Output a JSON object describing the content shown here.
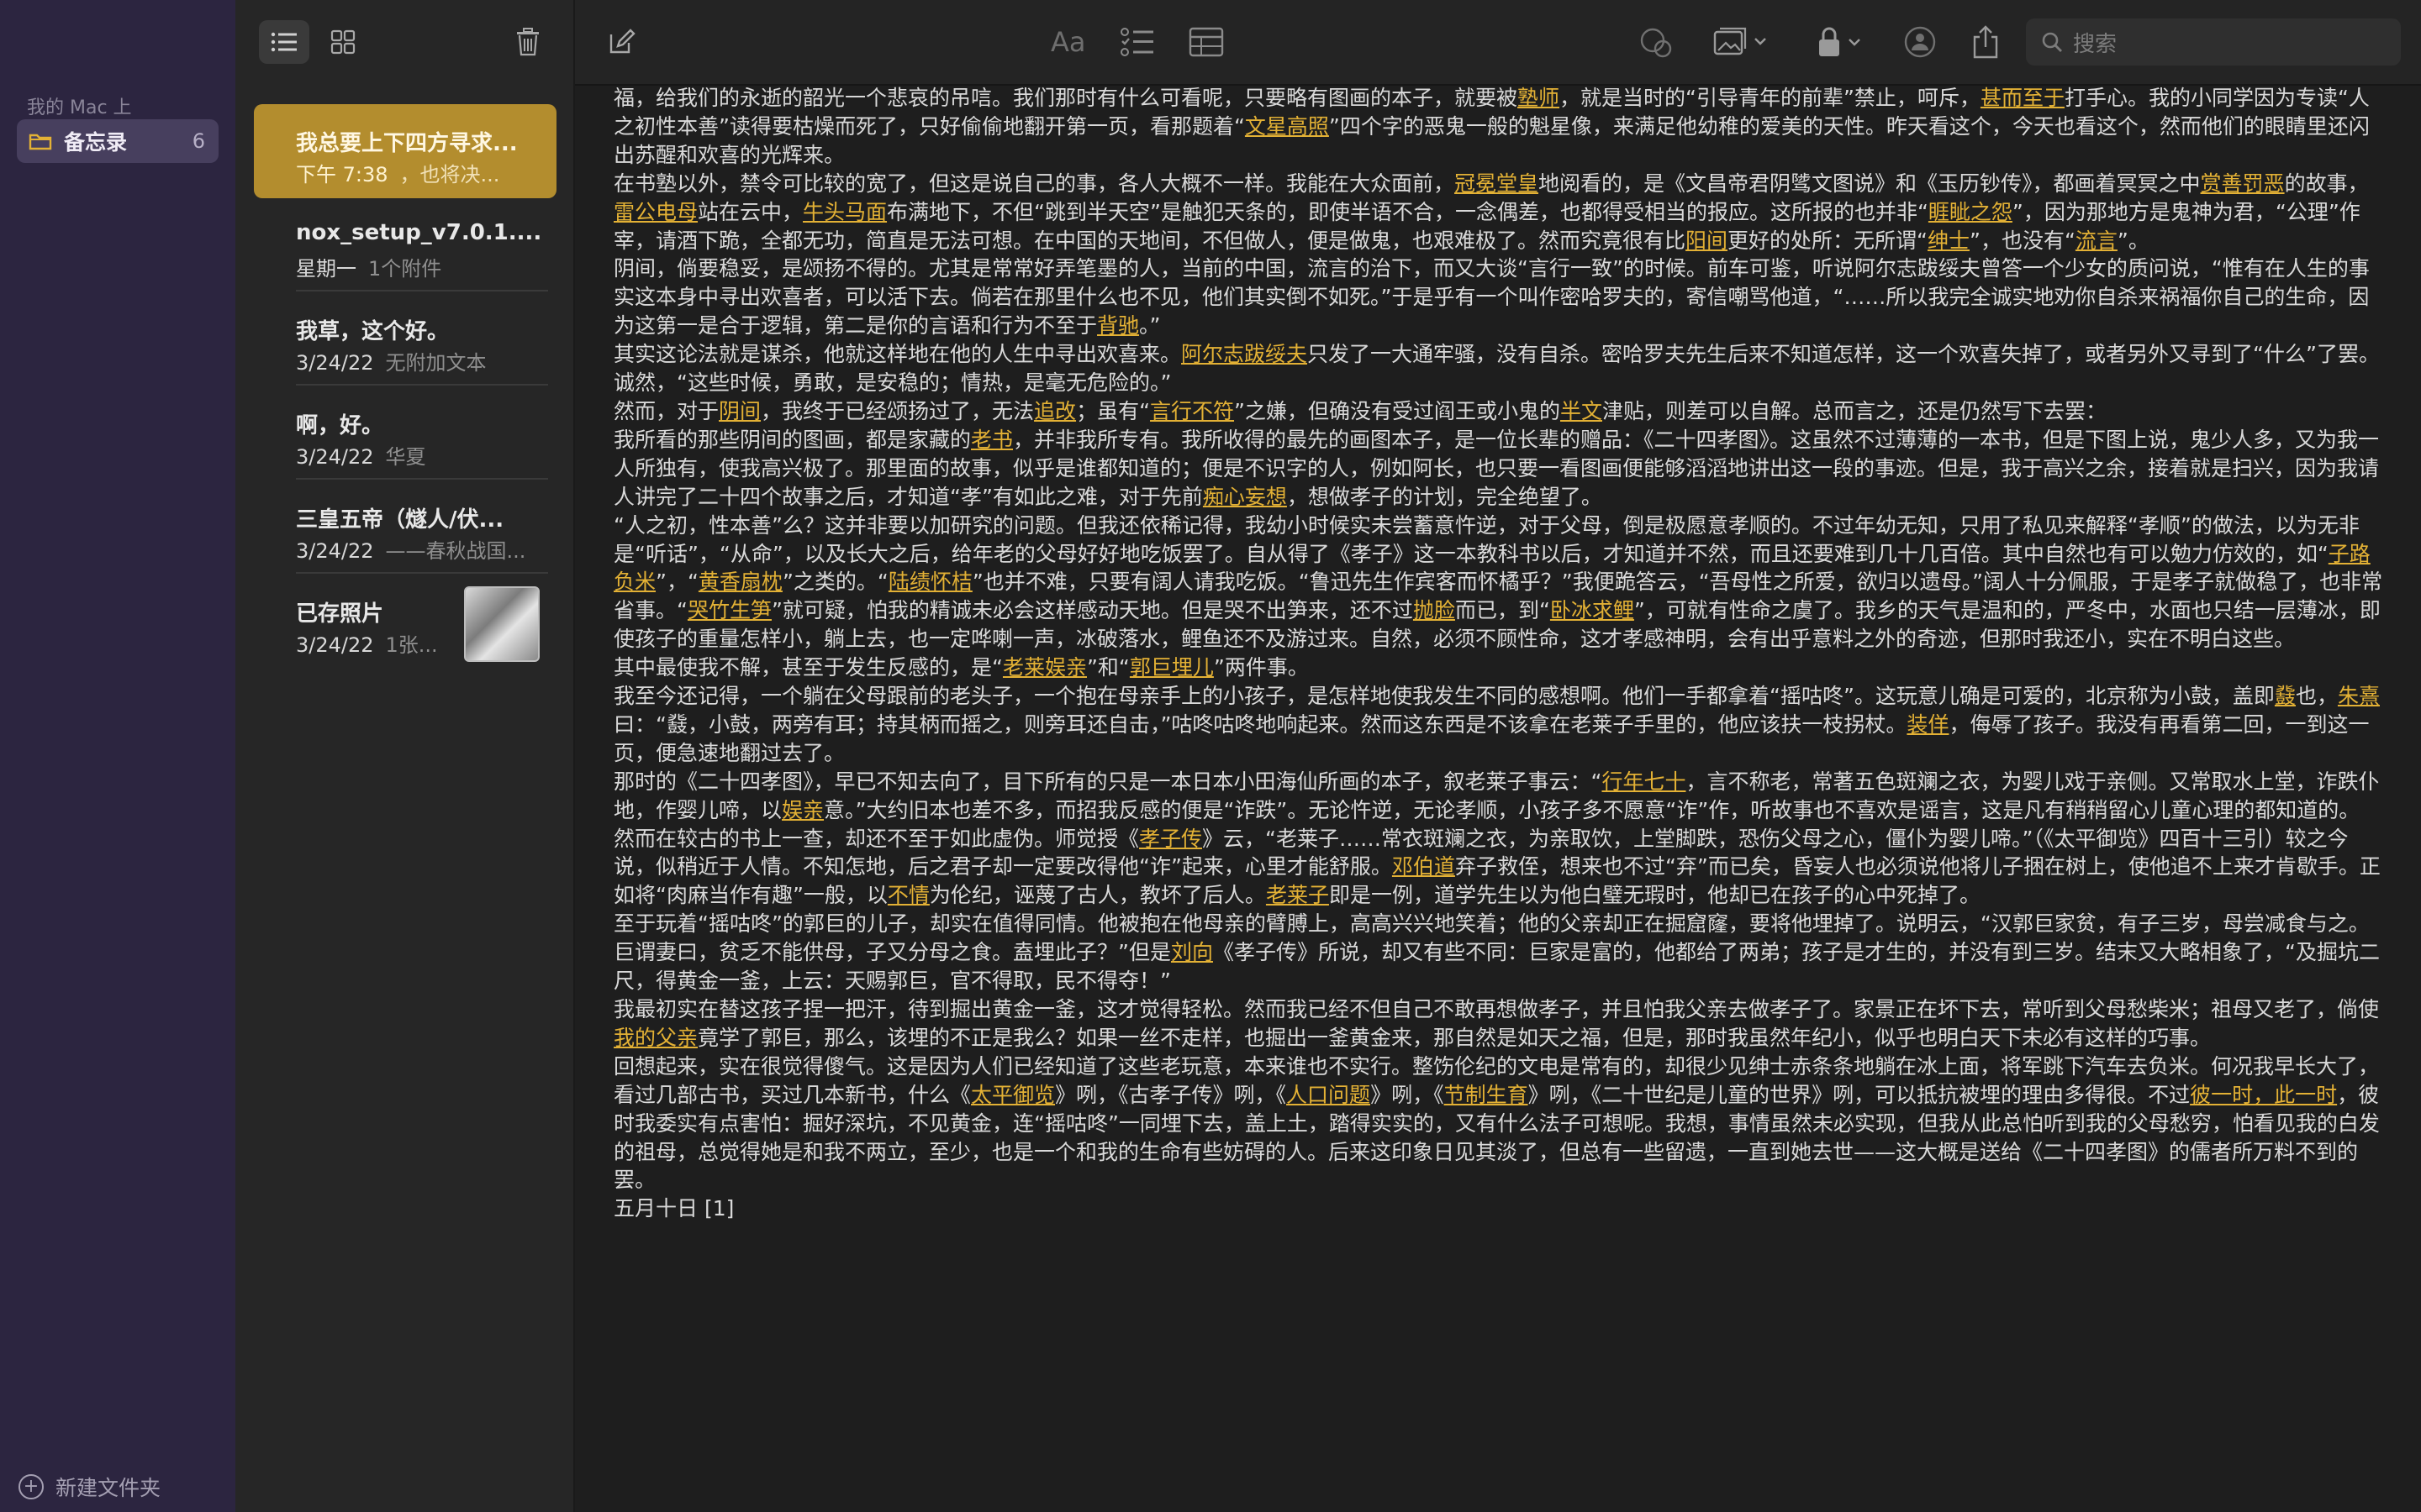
{
  "sidebar": {
    "section_title": "我的 Mac 上",
    "folder": {
      "label": "备忘录",
      "count": "6"
    },
    "new_folder": "新建文件夹"
  },
  "notes": [
    {
      "title": "我总要上下四方寻求...",
      "date": "下午 7:38",
      "preview": "，也将决..."
    },
    {
      "title": "nox_setup_v7.0.1....",
      "date": "星期一",
      "preview": "1个附件"
    },
    {
      "title": "我草，这个好。",
      "date": "3/24/22",
      "preview": "无附加文本"
    },
    {
      "title": "啊，好。",
      "date": "3/24/22",
      "preview": "华夏"
    },
    {
      "title": "三皇五帝（燧人/伏...",
      "date": "3/24/22",
      "preview": "——春秋战国..."
    },
    {
      "title": "已存照片",
      "date": "3/24/22",
      "preview": "1张..."
    }
  ],
  "toolbar": {
    "search_placeholder": "搜索",
    "format_label": "Aa"
  },
  "icons": {
    "list": "list-view-icon",
    "grid": "grid-view-icon",
    "trash": "trash-icon",
    "compose": "compose-icon",
    "checklist": "checklist-icon",
    "table": "table-icon",
    "share": "share-icon",
    "lock": "lock-icon"
  },
  "colors": {
    "accent": "#e3b135",
    "selected_note": "#b38d2e",
    "sidebar_bg": "#2c2540"
  },
  "doc": {
    "segments": [
      {
        "t": "福，给我们的永逝的韶光一个悲哀的吊唁。我们那时有什么可看呢，只要略有图画的本子，就要被"
      },
      {
        "t": "塾师",
        "l": 1
      },
      {
        "t": "，就是当时的“引导青年的前辈”禁止，呵斥，"
      },
      {
        "t": "甚而至于",
        "l": 1
      },
      {
        "t": "打手心。我的小同学因为专读“人之初性本善”读得要枯燥而死了，只好偷偷地翻开第一页，看那题着“"
      },
      {
        "t": "文星高照",
        "l": 1
      },
      {
        "t": "”四个字的恶鬼一般的魁星像，来满足他幼稚的爱美的天性。昨天看这个，今天也看这个，然而他们的眼睛里还闪出苏醒和欢喜的光辉来。\n在书塾以外，禁令可比较的宽了，但这是说自己的事，各人大概不一样。我能在大众面前，"
      },
      {
        "t": "冠冕堂皇",
        "l": 1
      },
      {
        "t": "地阅看的，是《文昌帝君阴骘文图说》和《玉历钞传》，都画着冥冥之中"
      },
      {
        "t": "赏善罚恶",
        "l": 1
      },
      {
        "t": "的故事，"
      },
      {
        "t": "雷公电母",
        "l": 1
      },
      {
        "t": "站在云中，"
      },
      {
        "t": "牛头马面",
        "l": 1
      },
      {
        "t": "布满地下，不但“跳到半天空”是触犯天条的，即使半语不合，一念偶差，也都得受相当的报应。这所报的也并非“"
      },
      {
        "t": "睚眦之怨",
        "l": 1
      },
      {
        "t": "”，因为那地方是鬼神为君，“公理”作宰，请酒下跪，全都无功，简直是无法可想。在中国的天地间，不但做人，便是做鬼，也艰难极了。然而究竟很有比"
      },
      {
        "t": "阳间",
        "l": 1
      },
      {
        "t": "更好的处所：无所谓“"
      },
      {
        "t": "绅士",
        "l": 1
      },
      {
        "t": "”，也没有“"
      },
      {
        "t": "流言",
        "l": 1
      },
      {
        "t": "”。\n阴间，倘要稳妥，是颂扬不得的。尤其是常常好弄笔墨的人，当前的中国，流言的治下，而又大谈“言行一致”的时候。前车可鉴，听说阿尔志跋绥夫曾答一个少女的质问说，“惟有在人生的事实这本身中寻出欢喜者，可以活下去。倘若在那里什么也不见，他们其实倒不如死。”于是乎有一个叫作密哈罗夫的，寄信嘲骂他道，“……所以我完全诚实地劝你自杀来祸福你自己的生命，因为这第一是合于逻辑，第二是你的言语和行为不至于"
      },
      {
        "t": "背驰",
        "l": 1
      },
      {
        "t": "。”\n其实这论法就是谋杀，他就这样地在他的人生中寻出欢喜来。"
      },
      {
        "t": "阿尔志跋绥夫",
        "l": 1
      },
      {
        "t": "只发了一大通牢骚，没有自杀。密哈罗夫先生后来不知道怎样，这一个欢喜失掉了，或者另外又寻到了“什么”了罢。诚然，“这些时候，勇敢，是安稳的；情热，是毫无危险的。”\n然而，对于"
      },
      {
        "t": "阴间",
        "l": 1
      },
      {
        "t": "，我终于已经颂扬过了，无法"
      },
      {
        "t": "追改",
        "l": 1
      },
      {
        "t": "；虽有“"
      },
      {
        "t": "言行不符",
        "l": 1
      },
      {
        "t": "”之嫌，但确没有受过阎王或小鬼的"
      },
      {
        "t": "半文",
        "l": 1
      },
      {
        "t": "津贴，则差可以自解。总而言之，还是仍然写下去罢：\n我所看的那些阴间的图画，都是家藏的"
      },
      {
        "t": "老书",
        "l": 1
      },
      {
        "t": "，并非我所专有。我所收得的最先的画图本子，是一位长辈的赠品：《二十四孝图》。这虽然不过薄薄的一本书，但是下图上说，鬼少人多，又为我一人所独有，使我高兴极了。那里面的故事，似乎是谁都知道的；便是不识字的人，例如阿长，也只要一看图画便能够滔滔地讲出这一段的事迹。但是，我于高兴之余，接着就是扫兴，因为我请人讲完了二十四个故事之后，才知道“孝”有如此之难，对于先前"
      },
      {
        "t": "痴心妄想",
        "l": 1
      },
      {
        "t": "，想做孝子的计划，完全绝望了。\n“人之初，性本善”么？这并非要以加研究的问题。但我还依稀记得，我幼小时候实未尝蓄意忤逆，对于父母，倒是极愿意孝顺的。不过年幼无知，只用了私见来解释“孝顺”的做法，以为无非是“听话”，“从命”，以及长大之后，给年老的父母好好地吃饭罢了。自从得了《孝子》这一本教科书以后，才知道并不然，而且还要难到几十几百倍。其中自然也有可以勉力仿效的，如“"
      },
      {
        "t": "子路负米",
        "l": 1
      },
      {
        "t": "”，“"
      },
      {
        "t": "黄香扇枕",
        "l": 1
      },
      {
        "t": "”之类的。“"
      },
      {
        "t": "陆绩怀桔",
        "l": 1
      },
      {
        "t": "”也并不难，只要有阔人请我吃饭。“鲁迅先生作宾客而怀橘乎？”我便跪答云，“吾母性之所爱，欲归以遗母。”阔人十分佩服，于是孝子就做稳了，也非常省事。“"
      },
      {
        "t": "哭竹生笋",
        "l": 1
      },
      {
        "t": "”就可疑，怕我的精诚未必会这样感动天地。但是哭不出笋来，还不过"
      },
      {
        "t": "抛脸",
        "l": 1
      },
      {
        "t": "而已，到“"
      },
      {
        "t": "卧冰求鲤",
        "l": 1
      },
      {
        "t": "”，可就有性命之虞了。我乡的天气是温和的，严冬中，水面也只结一层薄冰，即使孩子的重量怎样小，躺上去，也一定哗喇一声，冰破落水，鲤鱼还不及游过来。自然，必须不顾性命，这才孝感神明，会有出乎意料之外的奇迹，但那时我还小，实在不明白这些。\n其中最使我不解，甚至于发生反感的，是“"
      },
      {
        "t": "老莱娱亲",
        "l": 1
      },
      {
        "t": "”和“"
      },
      {
        "t": "郭巨埋儿",
        "l": 1
      },
      {
        "t": "”两件事。\n我至今还记得，一个躺在父母跟前的老头子，一个抱在母亲手上的小孩子，是怎样地使我发生不同的感想啊。他们一手都拿着“摇咕咚”。这玩意儿确是可爱的，北京称为小鼓，盖即"
      },
      {
        "t": "鼗",
        "l": 1
      },
      {
        "t": "也，"
      },
      {
        "t": "朱熹",
        "l": 1
      },
      {
        "t": "曰：“鼗，小鼓，两旁有耳；持其柄而摇之，则旁耳还自击，”咕咚咕咚地响起来。然而这东西是不该拿在老莱子手里的，他应该扶一枝拐杖。"
      },
      {
        "t": "装佯",
        "l": 1
      },
      {
        "t": "，侮辱了孩子。我没有再看第二回，一到这一页，便急速地翻过去了。\n那时的《二十四孝图》，早已不知去向了，目下所有的只是一本日本小田海仙所画的本子，叙老莱子事云：“"
      },
      {
        "t": "行年七十",
        "l": 1
      },
      {
        "t": "，言不称老，常著五色斑斓之衣，为婴儿戏于亲侧。又常取水上堂，诈跌仆地，作婴儿啼，以"
      },
      {
        "t": "娱亲",
        "l": 1
      },
      {
        "t": "意。”大约旧本也差不多，而招我反感的便是“诈跌”。无论忤逆，无论孝顺，小孩子多不愿意“诈”作，听故事也不喜欢是谣言，这是凡有稍稍留心儿童心理的都知道的。\n然而在较古的书上一查，却还不至于如此虚伪。师觉授《"
      },
      {
        "t": "孝子传",
        "l": 1
      },
      {
        "t": "》云，“老莱子……常衣斑斓之衣，为亲取饮，上堂脚跌，恐伤父母之心，僵仆为婴儿啼。”（《太平御览》四百十三引）较之今说，似稍近于人情。不知怎地，后之君子却一定要改得他“诈”起来，心里才能舒服。"
      },
      {
        "t": "邓伯道",
        "l": 1
      },
      {
        "t": "弃子救侄，想来也不过“弃”而已矣，昏妄人也必须说他将儿子捆在树上，使他追不上来才肯歇手。正如将“肉麻当作有趣”一般，以"
      },
      {
        "t": "不情",
        "l": 1
      },
      {
        "t": "为伦纪，诬蔑了古人，教坏了后人。"
      },
      {
        "t": "老莱子",
        "l": 1
      },
      {
        "t": "即是一例，道学先生以为他白璧无瑕时，他却已在孩子的心中死掉了。\n至于玩着“摇咕咚”的郭巨的儿子，却实在值得同情。他被抱在他母亲的臂膊上，高高兴兴地笑着；他的父亲却正在掘窟窿，要将他埋掉了。说明云，“汉郭巨家贫，有子三岁，母尝减食与之。巨谓妻曰，贫乏不能供母，子又分母之食。盍埋此子？”但是"
      },
      {
        "t": "刘向",
        "l": 1
      },
      {
        "t": "《孝子传》所说，却又有些不同：巨家是富的，他都给了两弟；孩子是才生的，并没有到三岁。结末又大略相象了，“及掘坑二尺，得黄金一釜，上云：天赐郭巨，官不得取，民不得夺！”\n我最初实在替这孩子捏一把汗，待到掘出黄金一釜，这才觉得轻松。然而我已经不但自己不敢再想做孝子，并且怕我父亲去做孝子了。家景正在坏下去，常听到父母愁柴米；祖母又老了，倘使"
      },
      {
        "t": "我的父亲",
        "l": 1
      },
      {
        "t": "竟学了郭巨，那么，该埋的不正是我么？如果一丝不走样，也掘出一釜黄金来，那自然是如天之福，但是，那时我虽然年纪小，似乎也明白天下未必有这样的巧事。\n回想起来，实在很觉得傻气。这是因为人们已经知道了这些老玩意，本来谁也不实行。整饬伦纪的文电是常有的，却很少见绅士赤条条地躺在冰上面，将军跳下汽车去负米。何况我早长大了，看过几部古书，买过几本新书，什么《"
      },
      {
        "t": "太平御览",
        "l": 1
      },
      {
        "t": "》咧，《古孝子传》咧，《"
      },
      {
        "t": "人口问题",
        "l": 1
      },
      {
        "t": "》咧，《"
      },
      {
        "t": "节制生育",
        "l": 1
      },
      {
        "t": "》咧，《二十世纪是儿童的世界》咧，可以抵抗被埋的理由多得很。不过"
      },
      {
        "t": "彼一时，此一时",
        "l": 1
      },
      {
        "t": "，彼时我委实有点害怕：掘好深坑，不见黄金，连“摇咕咚”一同埋下去，盖上土，踏得实实的，又有什么法子可想呢。我想，事情虽然未必实现，但我从此总怕听到我的父母愁穷，怕看见我的白发的祖母，总觉得她是和我不两立，至少，也是一个和我的生命有些妨碍的人。后来这印象日见其淡了，但总有一些留遗，一直到她去世——这大概是送给《二十四孝图》的儒者所万料不到的罢。\n五月十日 [1]"
      }
    ]
  }
}
